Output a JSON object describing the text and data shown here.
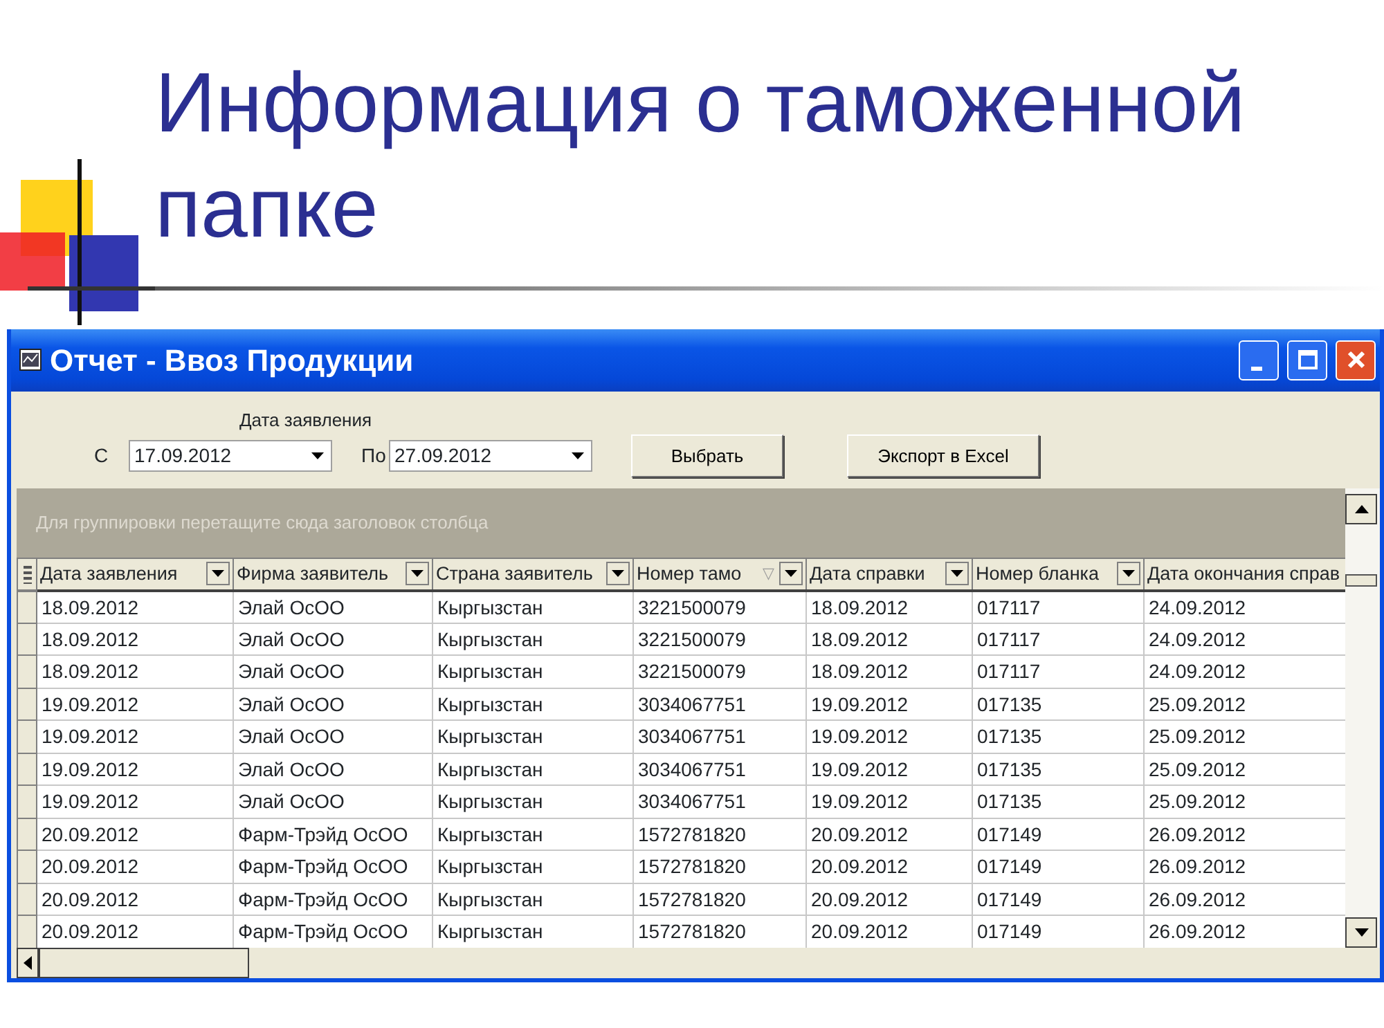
{
  "slide": {
    "title": "Информация о таможенной папке"
  },
  "window": {
    "title": "Отчет - Ввоз Продукции"
  },
  "filter": {
    "group_label": "Дата заявления",
    "from_label": "С",
    "from_value": "17.09.2012",
    "to_label": "По",
    "to_value": "27.09.2012"
  },
  "buttons": [
    "Выбрать",
    "Экспорт в Excel"
  ],
  "group_hint": "Для группировки перетащите сюда заголовок столбца",
  "table": {
    "columns": [
      {
        "label": "Дата заявления"
      },
      {
        "label": "Фирма заявитель"
      },
      {
        "label": "Страна заявитель"
      },
      {
        "label": "Номер тамо",
        "sort_mark": "▽"
      },
      {
        "label": "Дата справки"
      },
      {
        "label": "Номер бланка"
      },
      {
        "label": "Дата окончания справ"
      }
    ],
    "rows": [
      [
        "18.09.2012",
        "Элай ОсОО",
        "Кыргызстан",
        "3221500079",
        "18.09.2012",
        "017117",
        "24.09.2012"
      ],
      [
        "18.09.2012",
        "Элай ОсОО",
        "Кыргызстан",
        "3221500079",
        "18.09.2012",
        "017117",
        "24.09.2012"
      ],
      [
        "18.09.2012",
        "Элай ОсОО",
        "Кыргызстан",
        "3221500079",
        "18.09.2012",
        "017117",
        "24.09.2012"
      ],
      [
        "19.09.2012",
        "Элай ОсОО",
        "Кыргызстан",
        "3034067751",
        "19.09.2012",
        "017135",
        "25.09.2012"
      ],
      [
        "19.09.2012",
        "Элай ОсОО",
        "Кыргызстан",
        "3034067751",
        "19.09.2012",
        "017135",
        "25.09.2012"
      ],
      [
        "19.09.2012",
        "Элай ОсОО",
        "Кыргызстан",
        "3034067751",
        "19.09.2012",
        "017135",
        "25.09.2012"
      ],
      [
        "19.09.2012",
        "Элай ОсОО",
        "Кыргызстан",
        "3034067751",
        "19.09.2012",
        "017135",
        "25.09.2012"
      ],
      [
        "20.09.2012",
        "Фарм-Трэйд ОсОО",
        "Кыргызстан",
        "1572781820",
        "20.09.2012",
        "017149",
        "26.09.2012"
      ],
      [
        "20.09.2012",
        "Фарм-Трэйд ОсОО",
        "Кыргызстан",
        "1572781820",
        "20.09.2012",
        "017149",
        "26.09.2012"
      ],
      [
        "20.09.2012",
        "Фарм-Трэйд ОсОО",
        "Кыргызстан",
        "1572781820",
        "20.09.2012",
        "017149",
        "26.09.2012"
      ],
      [
        "20.09.2012",
        "Фарм-Трэйд ОсОО",
        "Кыргызстан",
        "1572781820",
        "20.09.2012",
        "017149",
        "26.09.2012"
      ]
    ]
  }
}
